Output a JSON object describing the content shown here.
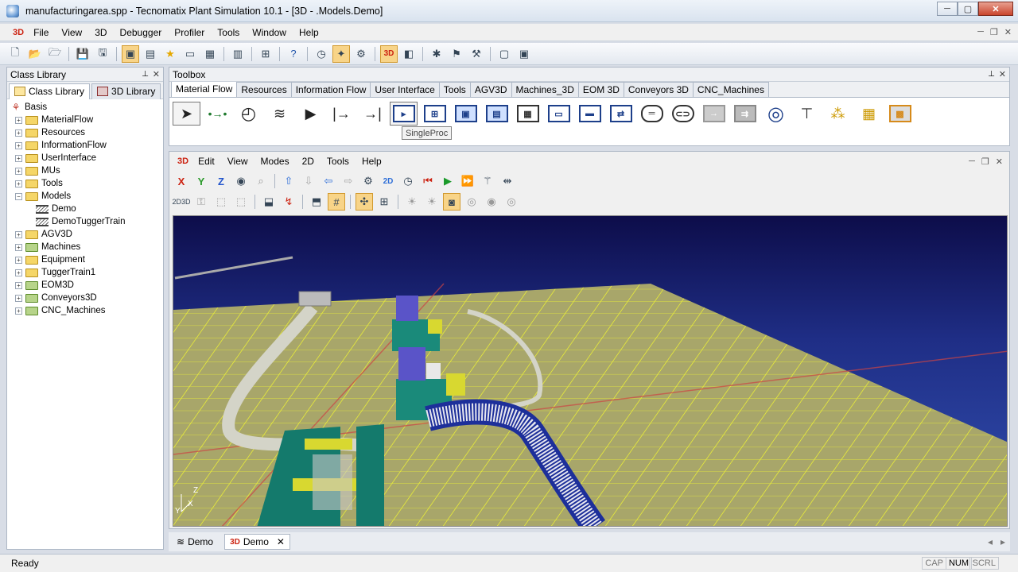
{
  "window": {
    "title": "manufacturingarea.spp - Tecnomatix Plant Simulation 10.1 - [3D - .Models.Demo]",
    "min": "─",
    "max": "▢",
    "close": "✕"
  },
  "menubar": {
    "icon_label": "3D",
    "items": [
      "File",
      "View",
      "3D",
      "Debugger",
      "Profiler",
      "Tools",
      "Window",
      "Help"
    ]
  },
  "class_library": {
    "title": "Class Library",
    "tabs": [
      "Class Library",
      "3D Library"
    ],
    "tree": [
      {
        "label": "Basis",
        "type": "root"
      },
      {
        "label": "MaterialFlow",
        "type": "folder",
        "exp": "+"
      },
      {
        "label": "Resources",
        "type": "folder",
        "exp": "+"
      },
      {
        "label": "InformationFlow",
        "type": "folder",
        "exp": "+"
      },
      {
        "label": "UserInterface",
        "type": "folder",
        "exp": "+"
      },
      {
        "label": "MUs",
        "type": "folder",
        "exp": "+"
      },
      {
        "label": "Tools",
        "type": "folder",
        "exp": "+"
      },
      {
        "label": "Models",
        "type": "folder",
        "exp": "−"
      },
      {
        "label": "Demo",
        "type": "frame"
      },
      {
        "label": "DemoTuggerTrain",
        "type": "frame"
      },
      {
        "label": "AGV3D",
        "type": "folder",
        "exp": "+"
      },
      {
        "label": "Machines",
        "type": "lib",
        "exp": "+"
      },
      {
        "label": "Equipment",
        "type": "folder",
        "exp": "+"
      },
      {
        "label": "TuggerTrain1",
        "type": "folder",
        "exp": "+"
      },
      {
        "label": "EOM3D",
        "type": "lib",
        "exp": "+"
      },
      {
        "label": "Conveyors3D",
        "type": "lib",
        "exp": "+"
      },
      {
        "label": "CNC_Machines",
        "type": "lib",
        "exp": "+"
      }
    ]
  },
  "toolbox": {
    "title": "Toolbox",
    "tabs": [
      "Material Flow",
      "Resources",
      "Information Flow",
      "User Interface",
      "Tools",
      "AGV3D",
      "Machines_3D",
      "EOM 3D",
      "Conveyors 3D",
      "CNC_Machines"
    ],
    "tooltip": "SingleProc"
  },
  "view3d": {
    "menu_icon": "3D",
    "menu": [
      "Edit",
      "View",
      "Modes",
      "2D",
      "Tools",
      "Help"
    ],
    "axis_labels": {
      "z": "Z",
      "x": "X",
      "y": "Y"
    }
  },
  "doc_tabs": [
    {
      "label": "Demo",
      "active": false
    },
    {
      "label": "Demo",
      "prefix": "3D",
      "active": true
    }
  ],
  "status": {
    "text": "Ready",
    "caps": "CAP",
    "num": "NUM",
    "scrl": "SCRL"
  },
  "colors": {
    "sky_top": "#0d0d4a",
    "floor": "#a8a66a",
    "grid": "#e6ea3a",
    "machine_teal": "#1a8a7a",
    "conveyor_blue": "#1d2f9a"
  }
}
